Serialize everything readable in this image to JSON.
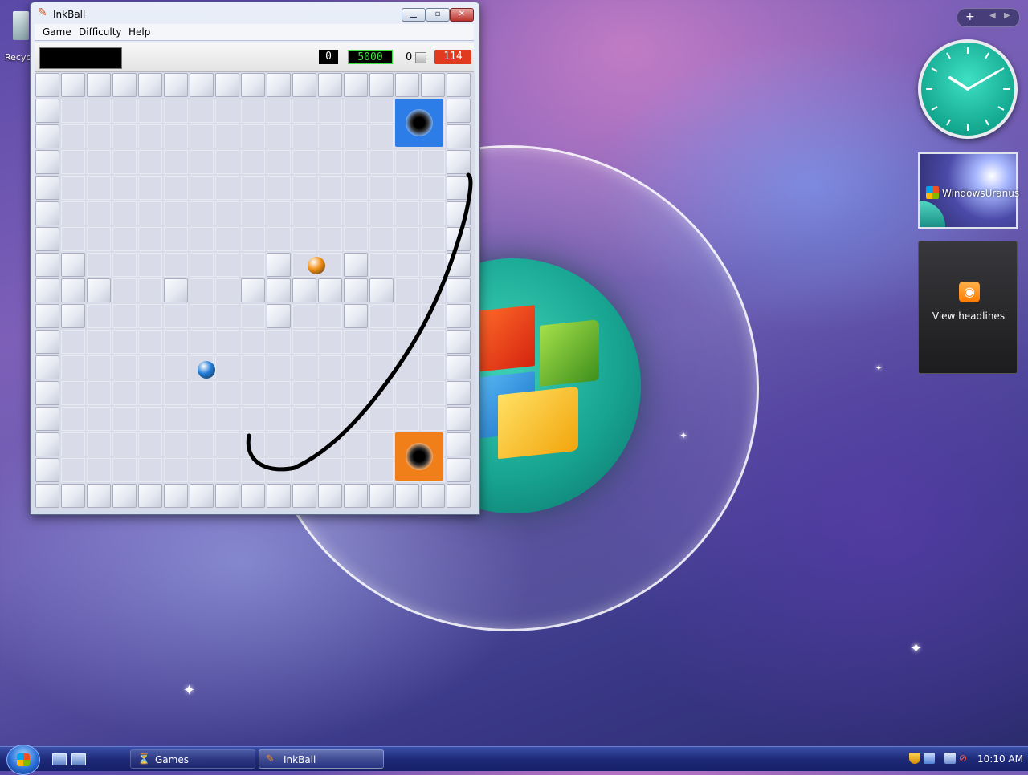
{
  "window": {
    "title": "InkBall"
  },
  "menu": {
    "items": [
      "Game",
      "Difficulty",
      "Help"
    ]
  },
  "status": {
    "score": "0",
    "timer": "5000",
    "captured": "0",
    "remaining": "114"
  },
  "desktop": {
    "recycle_label": "Recyc"
  },
  "gadgets": {
    "slideshow_text": "WindowsUranus",
    "feed_label": "View headlines",
    "sidebar_plus": "+"
  },
  "taskbar": {
    "tasks": [
      {
        "label": "Games"
      },
      {
        "label": "InkBall"
      }
    ],
    "clock": "10:10 AM"
  },
  "colors": {
    "hole_blue": "#2d7de8",
    "hole_orange": "#f07f1a",
    "ball_blue": "#1f7bd8",
    "ball_orange": "#f08d12",
    "timer_green": "#3ce043",
    "remaining_red": "#e23a1f"
  },
  "icons": {
    "app": "inkball-icon",
    "minimize": "minimize-icon",
    "maximize": "maximize-icon",
    "close": "close-icon"
  }
}
